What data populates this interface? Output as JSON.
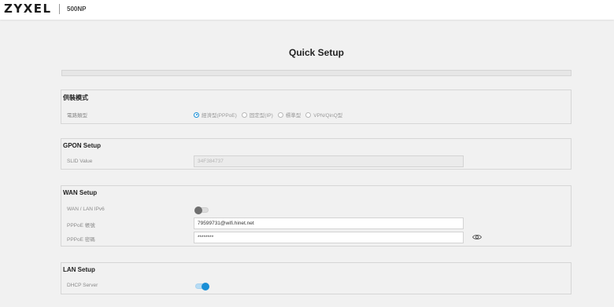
{
  "header": {
    "brand": "ZYXEL",
    "model": "500NP"
  },
  "page": {
    "title": "Quick Setup"
  },
  "wizard_progress": 0,
  "sections": {
    "service_mode": {
      "title": "供裝模式",
      "current_type_label": "電路類型",
      "options": [
        "經濟型(PPPoE)",
        "固定型(IP)",
        "標準型",
        "VPN/QinQ型"
      ],
      "selected": "經濟型(PPPoE)"
    },
    "gpon": {
      "title": "GPON Setup",
      "slid_label": "SLID Value",
      "slid_value": "34F384737"
    },
    "wan": {
      "title": "WAN Setup",
      "ipv6_label": "WAN / LAN IPv6",
      "ipv6_enabled": false,
      "pppoe_account_label": "PPPoE 帳號",
      "pppoe_account_value": "79599731@wifi.hinet.net",
      "pppoe_password_label": "PPPoE 密碼",
      "pppoe_password_value": "********"
    },
    "lan": {
      "title": "LAN Setup",
      "dhcp_label": "DHCP Server",
      "dhcp_enabled": true
    }
  },
  "icons": {
    "password_visibility": "eye-icon"
  },
  "colors": {
    "accent": "#1a8fd6",
    "background": "#f1f1f1"
  }
}
